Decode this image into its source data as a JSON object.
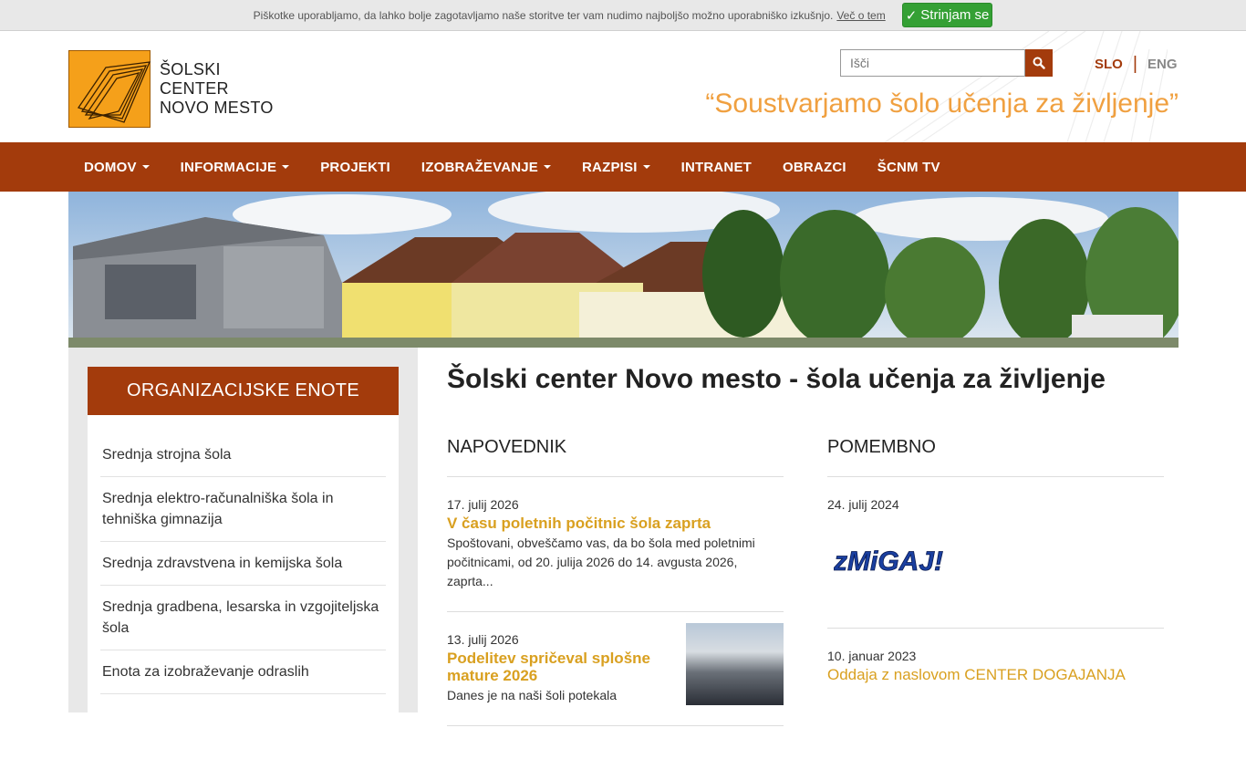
{
  "cookie": {
    "text": "Piškotke uporabljamo, da lahko bolje zagotavljamo naše storitve ter vam nudimo najboljšo možno uporabniško izkušnjo.",
    "more_link": "Več o tem",
    "accept_label": "Strinjam se",
    "accept_icon": "✓"
  },
  "header": {
    "logo_line1": "ŠOLSKI CENTER",
    "logo_line2": "NOVO MESTO",
    "search_placeholder": "Išči",
    "lang_slo": "SLO",
    "lang_eng": "ENG",
    "lang_sep": "|",
    "motto": "“Soustvarjamo šolo učenja za življenje”"
  },
  "nav": [
    {
      "label": "DOMOV",
      "dropdown": true
    },
    {
      "label": "INFORMACIJE",
      "dropdown": true
    },
    {
      "label": "PROJEKTI",
      "dropdown": false
    },
    {
      "label": "IZOBRAŽEVANJE",
      "dropdown": true
    },
    {
      "label": "RAZPISI",
      "dropdown": true
    },
    {
      "label": "INTRANET",
      "dropdown": false
    },
    {
      "label": "OBRAZCI",
      "dropdown": false
    },
    {
      "label": "ŠCNM TV",
      "dropdown": false
    }
  ],
  "sidebar": {
    "title": "ORGANIZACIJSKE ENOTE",
    "items": [
      "Srednja strojna šola",
      "Srednja elektro-računalniška šola in tehniška gimnazija",
      "Srednja zdravstvena in kemijska šola",
      "Srednja gradbena, lesarska in vzgojiteljska šola",
      "Enota za izobraževanje odraslih"
    ]
  },
  "main": {
    "title": "Šolski center Novo mesto - šola učenja za življenje",
    "napovednik": {
      "heading": "NAPOVEDNIK",
      "news": [
        {
          "date": "17. julij 2026",
          "title": "V času poletnih počitnic šola zaprta",
          "text": "Spoštovani, obveščamo vas, da bo šola med poletnimi počitnicami, od 20. julija 2026 do 14. avgusta 2026, zaprta..."
        },
        {
          "date": "13. julij 2026",
          "title": "Podelitev spričeval splošne mature 2026",
          "text": "Danes je na naši šoli potekala"
        }
      ]
    },
    "pomembno": {
      "heading": "POMEMBNO",
      "news": [
        {
          "date": "24. julij 2024",
          "image_text": "zMiGAJ!"
        },
        {
          "date": "10. januar 2023",
          "title": "Oddaja z naslovom CENTER DOGAJANJA"
        }
      ]
    }
  },
  "colors": {
    "brand": "#a33b0c",
    "accent": "#d9a020",
    "logo": "#f5a01a"
  }
}
